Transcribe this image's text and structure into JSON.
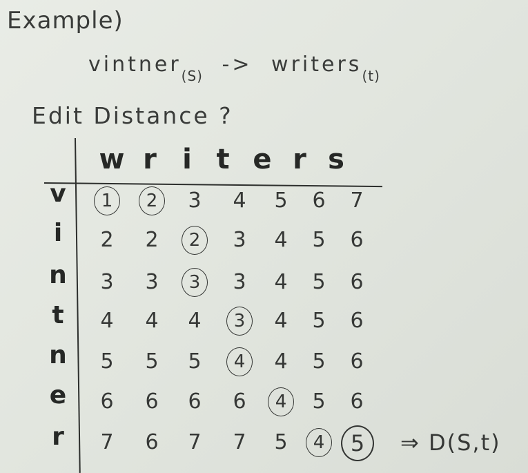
{
  "heading": "Example)",
  "transform": {
    "source": "vintner",
    "source_sub": "(S)",
    "arrow": "->",
    "target": "writers",
    "target_sub": "(t)"
  },
  "question": "Edit Distance ?",
  "columns": [
    "w",
    "r",
    "i",
    "t",
    "e",
    "r",
    "s"
  ],
  "rows": [
    {
      "label": "v",
      "cells": [
        "1",
        "2",
        "3",
        "4",
        "5",
        "6",
        "7"
      ],
      "circled": [
        0,
        1
      ]
    },
    {
      "label": "i",
      "cells": [
        "2",
        "2",
        "2",
        "3",
        "4",
        "5",
        "6"
      ],
      "circled": [
        2
      ]
    },
    {
      "label": "n",
      "cells": [
        "3",
        "3",
        "3",
        "3",
        "4",
        "5",
        "6"
      ],
      "circled": [
        2
      ]
    },
    {
      "label": "t",
      "cells": [
        "4",
        "4",
        "4",
        "3",
        "4",
        "5",
        "6"
      ],
      "circled": [
        3
      ]
    },
    {
      "label": "n",
      "cells": [
        "5",
        "5",
        "5",
        "4",
        "4",
        "5",
        "6"
      ],
      "circled": [
        3
      ]
    },
    {
      "label": "e",
      "cells": [
        "6",
        "6",
        "6",
        "6",
        "4",
        "5",
        "6"
      ],
      "circled": [
        4
      ]
    },
    {
      "label": "r",
      "cells": [
        "7",
        "6",
        "7",
        "7",
        "5",
        "4",
        "5"
      ],
      "circled": [
        5,
        6
      ]
    }
  ],
  "result": "⇒ D(S,t)"
}
